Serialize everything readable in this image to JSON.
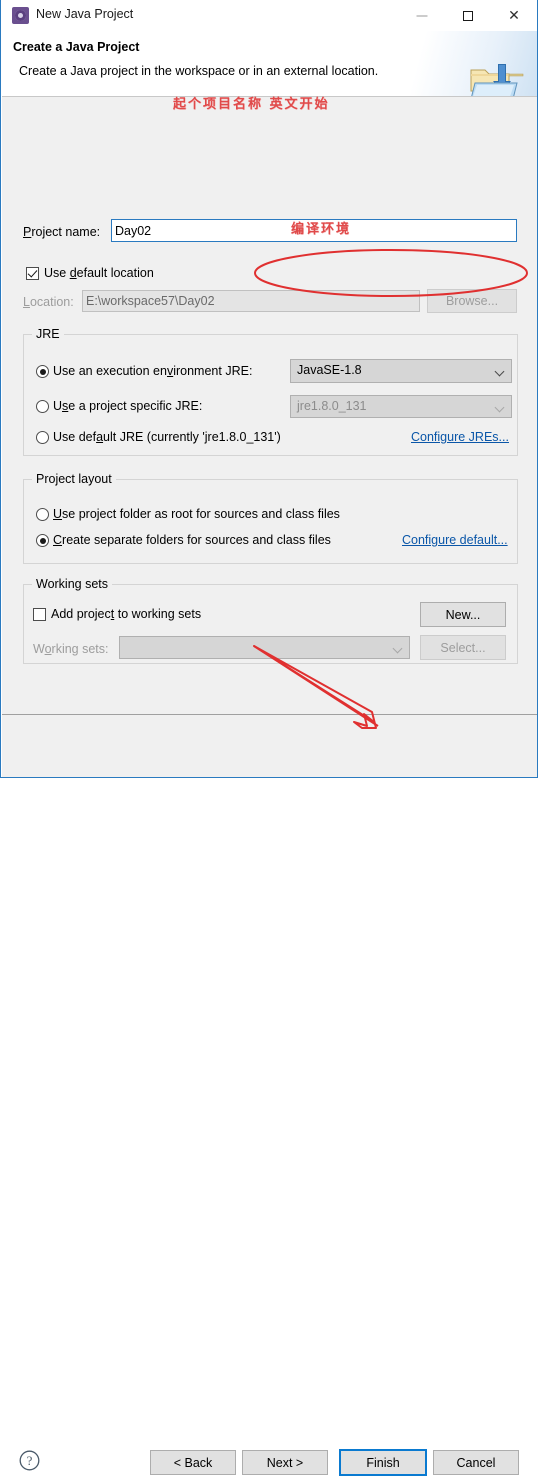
{
  "window": {
    "title": "New Java Project",
    "icon": "java-project-icon",
    "controls": {
      "minimize": "—",
      "maximize": "□",
      "close": "✕"
    }
  },
  "header": {
    "title": "Create a Java Project",
    "description": "Create a Java project in the workspace or in an external location.",
    "icon": "new-java-project-folder-icon"
  },
  "form": {
    "project_name_label": "Project name:",
    "project_name_value": "Day02",
    "project_name_placeholder": "",
    "use_default_location_label": "Use default location",
    "use_default_location_checked": true,
    "location_label": "Location:",
    "location_value": "E:\\workspace57\\Day02",
    "browse_label": "Browse..."
  },
  "jre": {
    "group_title": "JRE",
    "option_execution_env_label": "Use an execution environment JRE:",
    "option_execution_env_selected": true,
    "execution_env_value": "JavaSE-1.8",
    "option_project_specific_label": "Use a project specific JRE:",
    "option_project_specific_selected": false,
    "project_specific_value": "jre1.8.0_131",
    "option_default_jre_label": "Use default JRE (currently 'jre1.8.0_131')",
    "option_default_jre_selected": false,
    "configure_jres_link": "Configure JREs..."
  },
  "project_layout": {
    "group_title": "Project layout",
    "option_root_label": "Use project folder as root for sources and class files",
    "option_root_selected": false,
    "option_separate_label": "Create separate folders for sources and class files",
    "option_separate_selected": true,
    "configure_default_link": "Configure default..."
  },
  "working_sets": {
    "group_title": "Working sets",
    "add_project_label": "Add project to working sets",
    "add_project_checked": false,
    "new_label": "New...",
    "working_sets_label": "Working sets:",
    "working_sets_value": "",
    "select_label": "Select..."
  },
  "footer": {
    "help_icon": "help-question-icon",
    "back_label": "< Back",
    "next_label": "Next >",
    "finish_label": "Finish",
    "cancel_label": "Cancel",
    "default_button": "Finish"
  },
  "annotations": {
    "name_hint": "起个项目名称 英文开始",
    "jre_hint": "编译环境",
    "color": "#e03030",
    "ellipse_target": "execution-environment-combo",
    "arrow_target": "finish-button"
  },
  "colors": {
    "accent_blue": "#2a7ac0",
    "dialog_bg": "#f0f0f0",
    "link": "#0a56a8",
    "annotation_red": "#e03030"
  }
}
